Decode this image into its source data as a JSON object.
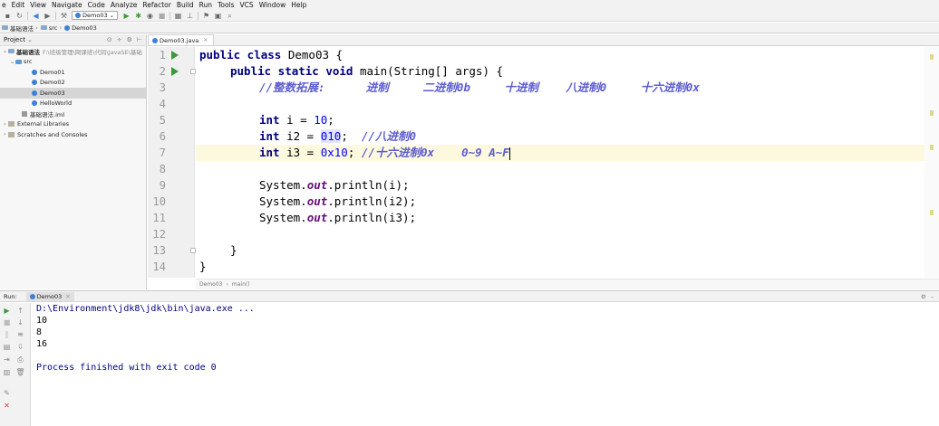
{
  "menu": [
    "e",
    "Edit",
    "View",
    "Navigate",
    "Code",
    "Analyze",
    "Refactor",
    "Build",
    "Run",
    "Tools",
    "VCS",
    "Window",
    "Help"
  ],
  "toolbar": {
    "run_config": "Demo03"
  },
  "breadcrumb": [
    "基础语法",
    "src",
    "Demo03"
  ],
  "project": {
    "title": "Project",
    "root_name": "基础语法",
    "root_path": "F:\\班级管理\\网课班\\代码\\JavaSE\\基础",
    "src": "src",
    "classes": [
      "Demo01",
      "Demo02",
      "Demo03",
      "HelloWorld"
    ],
    "iml": "基础语法.iml",
    "external": "External Libraries",
    "scratches": "Scratches and Consoles"
  },
  "editor": {
    "tab": "Demo03.java",
    "line_numbers": [
      "1",
      "2",
      "3",
      "4",
      "5",
      "6",
      "7",
      "8",
      "9",
      "10",
      "11",
      "12",
      "13",
      "14"
    ],
    "crumbs": [
      "Demo03",
      "main()"
    ],
    "code": {
      "l1_kw": "public class",
      "l1_rest": " Demo03 {",
      "l2_kw": "public static void",
      "l2_rest": " main(String[] args) {",
      "l3_comment": "//整数拓展:      进制     二进制0b     十进制    八进制0     十六进制0x",
      "l5_kw": "int",
      "l5_rest": " i = ",
      "l5_num": "10",
      "l5_end": ";",
      "l6_kw": "int",
      "l6_rest": " i2 = ",
      "l6_num": "010",
      "l6_end": ";  ",
      "l6_comment": "//八进制0",
      "l7_kw": "int",
      "l7_rest": " i3 = ",
      "l7_num": "0x10",
      "l7_end": "; ",
      "l7_comment": "//十六进制0x    0~9 A~F",
      "l9_a": "System.",
      "l9_out": "out",
      "l9_b": ".println(i);",
      "l10_a": "System.",
      "l10_out": "out",
      "l10_b": ".println(i2);",
      "l11_a": "System.",
      "l11_out": "out",
      "l11_b": ".println(i3);",
      "l13": "}",
      "l14": "}"
    }
  },
  "run": {
    "label": "Run:",
    "tab": "Demo03",
    "output": [
      "D:\\Environment\\jdk8\\jdk\\bin\\java.exe ...",
      "10",
      "8",
      "16",
      "",
      "Process finished with exit code 0"
    ]
  }
}
